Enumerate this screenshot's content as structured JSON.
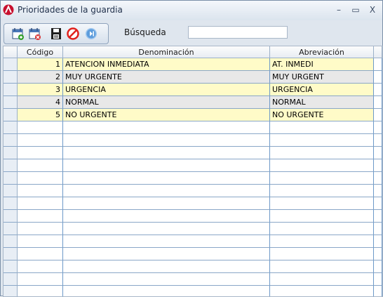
{
  "window": {
    "title": "Prioridades de la guardia"
  },
  "window_controls": {
    "minimize": "–",
    "maximize": "▭",
    "close": "X"
  },
  "toolbar": {
    "search_label": "Búsqueda",
    "search_value": ""
  },
  "table": {
    "headers": [
      "Código",
      "Denominación",
      "Abreviación"
    ],
    "rows": [
      {
        "codigo": "1",
        "denominacion": "ATENCION INMEDIATA",
        "abreviacion": "AT. INMEDI",
        "highlight": "yellow"
      },
      {
        "codigo": "2",
        "denominacion": "MUY URGENTE",
        "abreviacion": "MUY URGENT",
        "highlight": "gray"
      },
      {
        "codigo": "3",
        "denominacion": "URGENCIA",
        "abreviacion": "URGENCIA",
        "highlight": "yellow"
      },
      {
        "codigo": "4",
        "denominacion": "NORMAL",
        "abreviacion": "NORMAL",
        "highlight": "gray"
      },
      {
        "codigo": "5",
        "denominacion": "NO URGENTE",
        "abreviacion": "NO URGENTE",
        "highlight": "yellow"
      }
    ],
    "empty_rows": 14
  },
  "colors": {
    "row_yellow": "#fffbc8",
    "row_gray": "#e8e8e8",
    "grid_line": "#6d99c8"
  }
}
